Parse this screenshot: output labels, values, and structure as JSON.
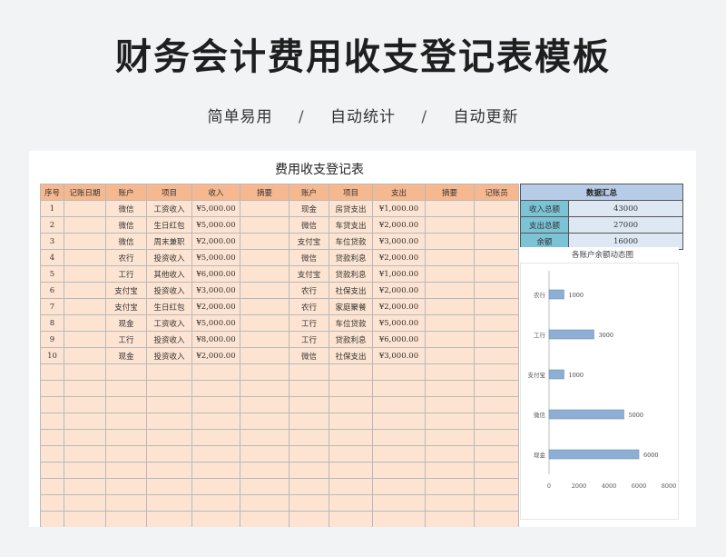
{
  "page": {
    "headline": "财务会计费用收支登记表模板",
    "features": [
      "简单易用",
      "自动统计",
      "自动更新"
    ],
    "separator": "/"
  },
  "sheet": {
    "title": "费用收支登记表",
    "columns": [
      "序号",
      "记账日期",
      "账户",
      "项目",
      "收入",
      "摘要",
      "账户",
      "项目",
      "支出",
      "摘要",
      "记账员"
    ],
    "rows": [
      [
        "1",
        "",
        "微信",
        "工资收入",
        "¥5,000.00",
        "",
        "现金",
        "房贷支出",
        "¥1,000.00",
        "",
        ""
      ],
      [
        "2",
        "",
        "微信",
        "生日红包",
        "¥5,000.00",
        "",
        "微信",
        "车贷支出",
        "¥2,000.00",
        "",
        ""
      ],
      [
        "3",
        "",
        "微信",
        "周末兼职",
        "¥2,000.00",
        "",
        "支付宝",
        "车位贷款",
        "¥3,000.00",
        "",
        ""
      ],
      [
        "4",
        "",
        "农行",
        "投资收入",
        "¥5,000.00",
        "",
        "微信",
        "贷款利息",
        "¥2,000.00",
        "",
        ""
      ],
      [
        "5",
        "",
        "工行",
        "其他收入",
        "¥6,000.00",
        "",
        "支付宝",
        "贷款利息",
        "¥1,000.00",
        "",
        ""
      ],
      [
        "6",
        "",
        "支付宝",
        "投资收入",
        "¥3,000.00",
        "",
        "农行",
        "社保支出",
        "¥2,000.00",
        "",
        ""
      ],
      [
        "7",
        "",
        "支付宝",
        "生日红包",
        "¥2,000.00",
        "",
        "农行",
        "家庭聚餐",
        "¥2,000.00",
        "",
        ""
      ],
      [
        "8",
        "",
        "现金",
        "工资收入",
        "¥5,000.00",
        "",
        "工行",
        "车位贷款",
        "¥5,000.00",
        "",
        ""
      ],
      [
        "9",
        "",
        "工行",
        "投资收入",
        "¥8,000.00",
        "",
        "工行",
        "贷款利息",
        "¥6,000.00",
        "",
        ""
      ],
      [
        "10",
        "",
        "现金",
        "投资收入",
        "¥2,000.00",
        "",
        "微信",
        "社保支出",
        "¥3,000.00",
        "",
        ""
      ]
    ],
    "empty_rows": 10
  },
  "summary": {
    "header": "数据汇总",
    "items": [
      {
        "label": "收入总额",
        "value": "43000"
      },
      {
        "label": "支出总额",
        "value": "27000"
      },
      {
        "label": "余额",
        "value": "16000"
      }
    ]
  },
  "colors": {
    "header_fill": "#f6b88f",
    "cell_fill": "#fde4d2",
    "bar_fill": "#8eaed3",
    "summary_header": "#b7cce6",
    "summary_label": "#7cc3d6",
    "summary_value": "#dde8f3"
  },
  "chart_data": {
    "type": "bar",
    "orientation": "horizontal",
    "title": "各账户余额动态图",
    "categories": [
      "农行",
      "工行",
      "支付宝",
      "微信",
      "现金"
    ],
    "values": [
      1000,
      3000,
      1000,
      5000,
      6000
    ],
    "xlim": [
      0,
      8000
    ],
    "xticks": [
      0,
      2000,
      4000,
      6000,
      8000
    ],
    "grid": false,
    "data_labels": true
  }
}
